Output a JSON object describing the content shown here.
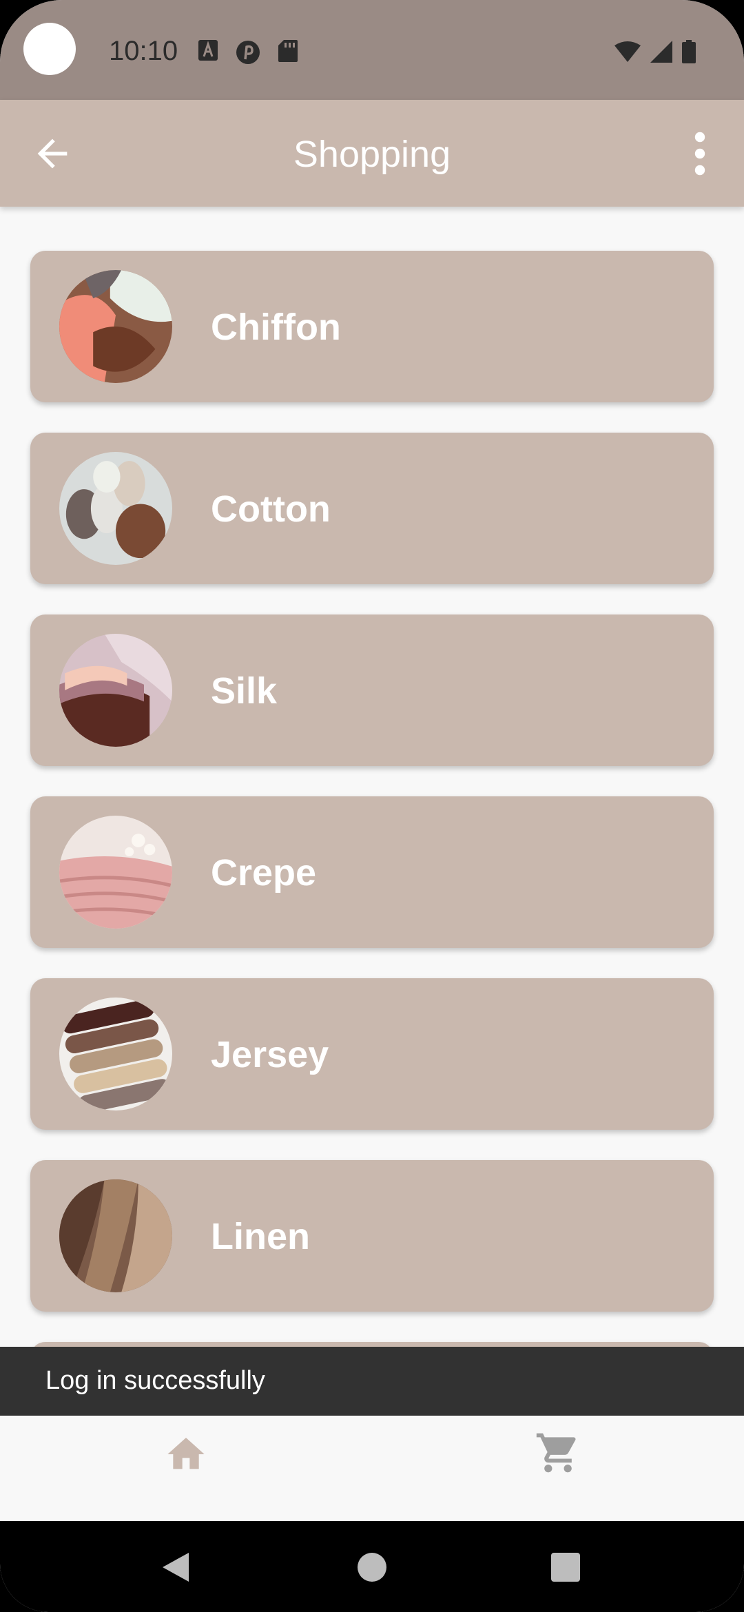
{
  "status_bar": {
    "time": "10:10",
    "icons": [
      "text-a-icon",
      "pinterest-icon",
      "sd-card-icon",
      "wifi-icon",
      "signal-icon",
      "battery-icon"
    ]
  },
  "app_bar": {
    "title": "Shopping",
    "back_icon": "arrow-back-icon",
    "menu_icon": "more-vert-icon",
    "background": "#c9b8ae"
  },
  "categories": [
    {
      "label": "Chiffon",
      "thumbnail": "chiffon-fabric-image"
    },
    {
      "label": "Cotton",
      "thumbnail": "cotton-fabric-image"
    },
    {
      "label": "Silk",
      "thumbnail": "silk-fabric-image"
    },
    {
      "label": "Crepe",
      "thumbnail": "crepe-fabric-image"
    },
    {
      "label": "Jersey",
      "thumbnail": "jersey-fabric-image"
    },
    {
      "label": "Linen",
      "thumbnail": "linen-fabric-image"
    }
  ],
  "snackbar": {
    "message": "Log in successfully"
  },
  "bottom_nav": {
    "items": [
      {
        "name": "home",
        "icon": "home-icon",
        "color": "#c9b8ae"
      },
      {
        "name": "cart",
        "icon": "cart-icon",
        "color": "#9e9e9e"
      }
    ]
  },
  "colors": {
    "accent": "#c9b8ae",
    "status_bar": "#9a8b85",
    "snackbar": "#323232",
    "background": "#f8f8f8"
  }
}
